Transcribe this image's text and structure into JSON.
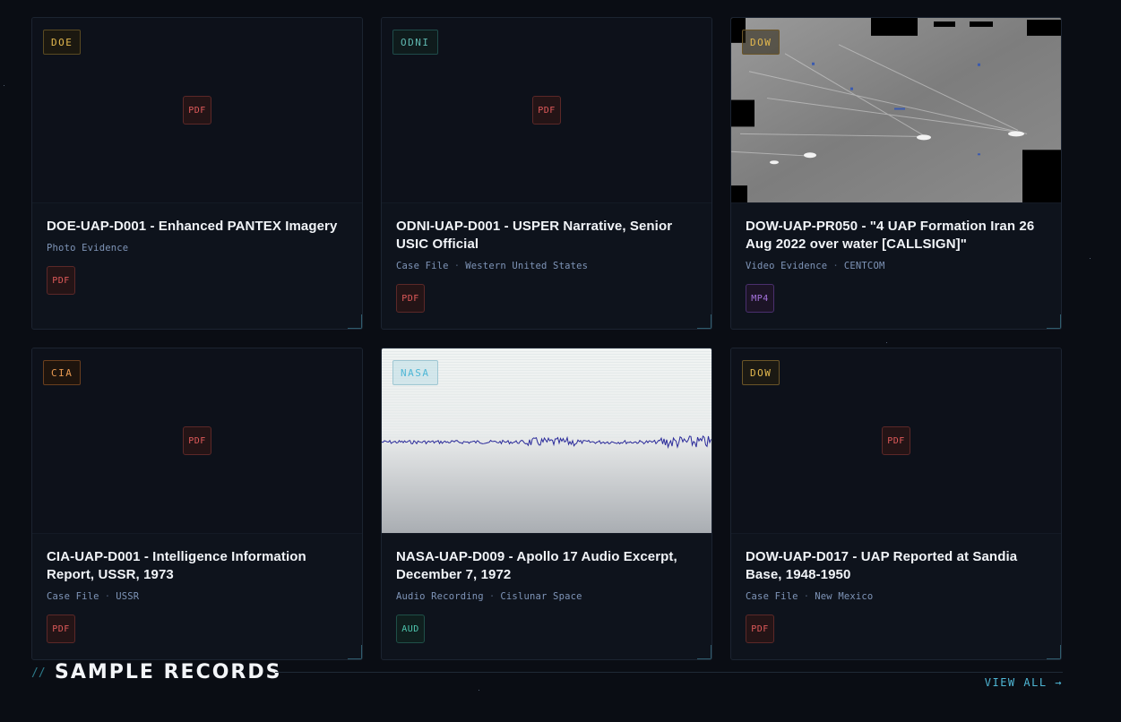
{
  "section": {
    "slash": "//",
    "title": "SAMPLE RECORDS",
    "view_all": "VIEW ALL →"
  },
  "cards": [
    {
      "agency": "DOE",
      "thumb_format": "PDF",
      "title": "DOE-UAP-D001 - Enhanced PANTEX Imagery",
      "type": "Photo Evidence",
      "location": "",
      "format": "PDF"
    },
    {
      "agency": "ODNI",
      "thumb_format": "PDF",
      "title": "ODNI-UAP-D001 - USPER Narrative, Senior USIC Official",
      "type": "Case File",
      "location": "Western United States",
      "format": "PDF"
    },
    {
      "agency": "DOW",
      "thumb_format": "",
      "title": "DOW-UAP-PR050 - \"4 UAP Formation Iran 26 Aug 2022 over water [CALLSIGN]\"",
      "type": "Video Evidence",
      "location": "CENTCOM",
      "format": "MP4"
    },
    {
      "agency": "CIA",
      "thumb_format": "PDF",
      "title": "CIA-UAP-D001 - Intelligence Information Report, USSR, 1973",
      "type": "Case File",
      "location": "USSR",
      "format": "PDF"
    },
    {
      "agency": "NASA",
      "thumb_format": "",
      "title": "NASA-UAP-D009 - Apollo 17 Audio Excerpt, December 7, 1972",
      "type": "Audio Recording",
      "location": "Cislunar Space",
      "format": "AUD"
    },
    {
      "agency": "DOW",
      "thumb_format": "PDF",
      "title": "DOW-UAP-D017 - UAP Reported at Sandia Base, 1948-1950",
      "type": "Case File",
      "location": "New Mexico",
      "format": "PDF"
    }
  ],
  "separator": "·"
}
